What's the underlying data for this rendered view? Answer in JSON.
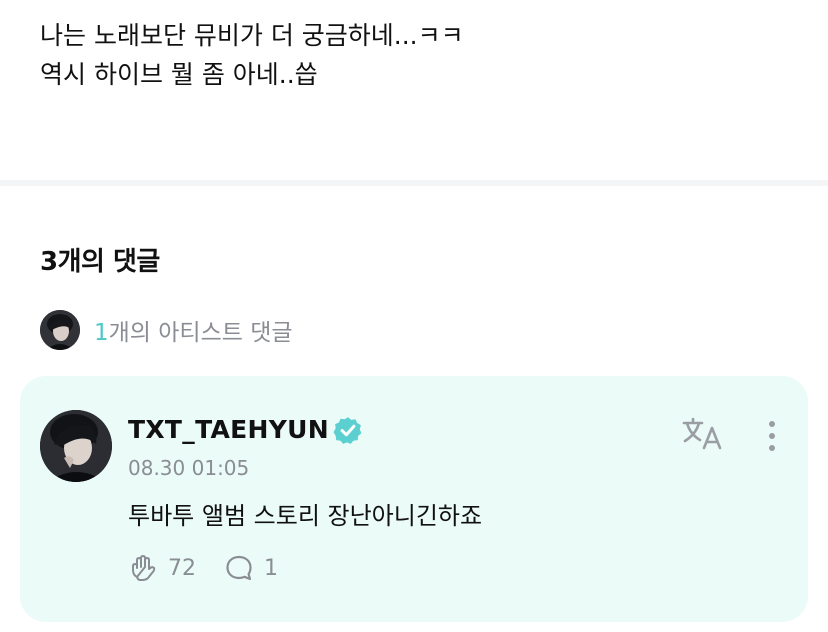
{
  "post": {
    "lines": [
      "나는 노래보단 뮤비가 더 궁금하네...ㅋㅋ",
      "역시 하이브 뭘 좀 아네..씁"
    ]
  },
  "comments": {
    "heading": "3개의 댓글",
    "artist_summary": {
      "count": "1",
      "suffix": "개의 아티스트 댓글",
      "avatar_icon": "artist-avatar-icon"
    },
    "items": [
      {
        "author": "TXT_TAEHYUN",
        "verified": true,
        "timestamp": "08.30 01:05",
        "text": "투바투 앨범 스토리 장난아니긴하죠",
        "like_count": "72",
        "reply_count": "1",
        "avatar_icon": "artist-avatar-icon"
      }
    ]
  },
  "colors": {
    "accent": "#4fc8c8",
    "card_background": "#ebfbf8",
    "muted_text": "#8a8d93",
    "verified_badge": "#5ccfd0"
  },
  "icons": {
    "verified": "verified-badge-icon",
    "translate": "translate-icon",
    "more": "more-vertical-icon",
    "like": "cheer-hand-icon",
    "reply": "speech-bubble-icon"
  }
}
